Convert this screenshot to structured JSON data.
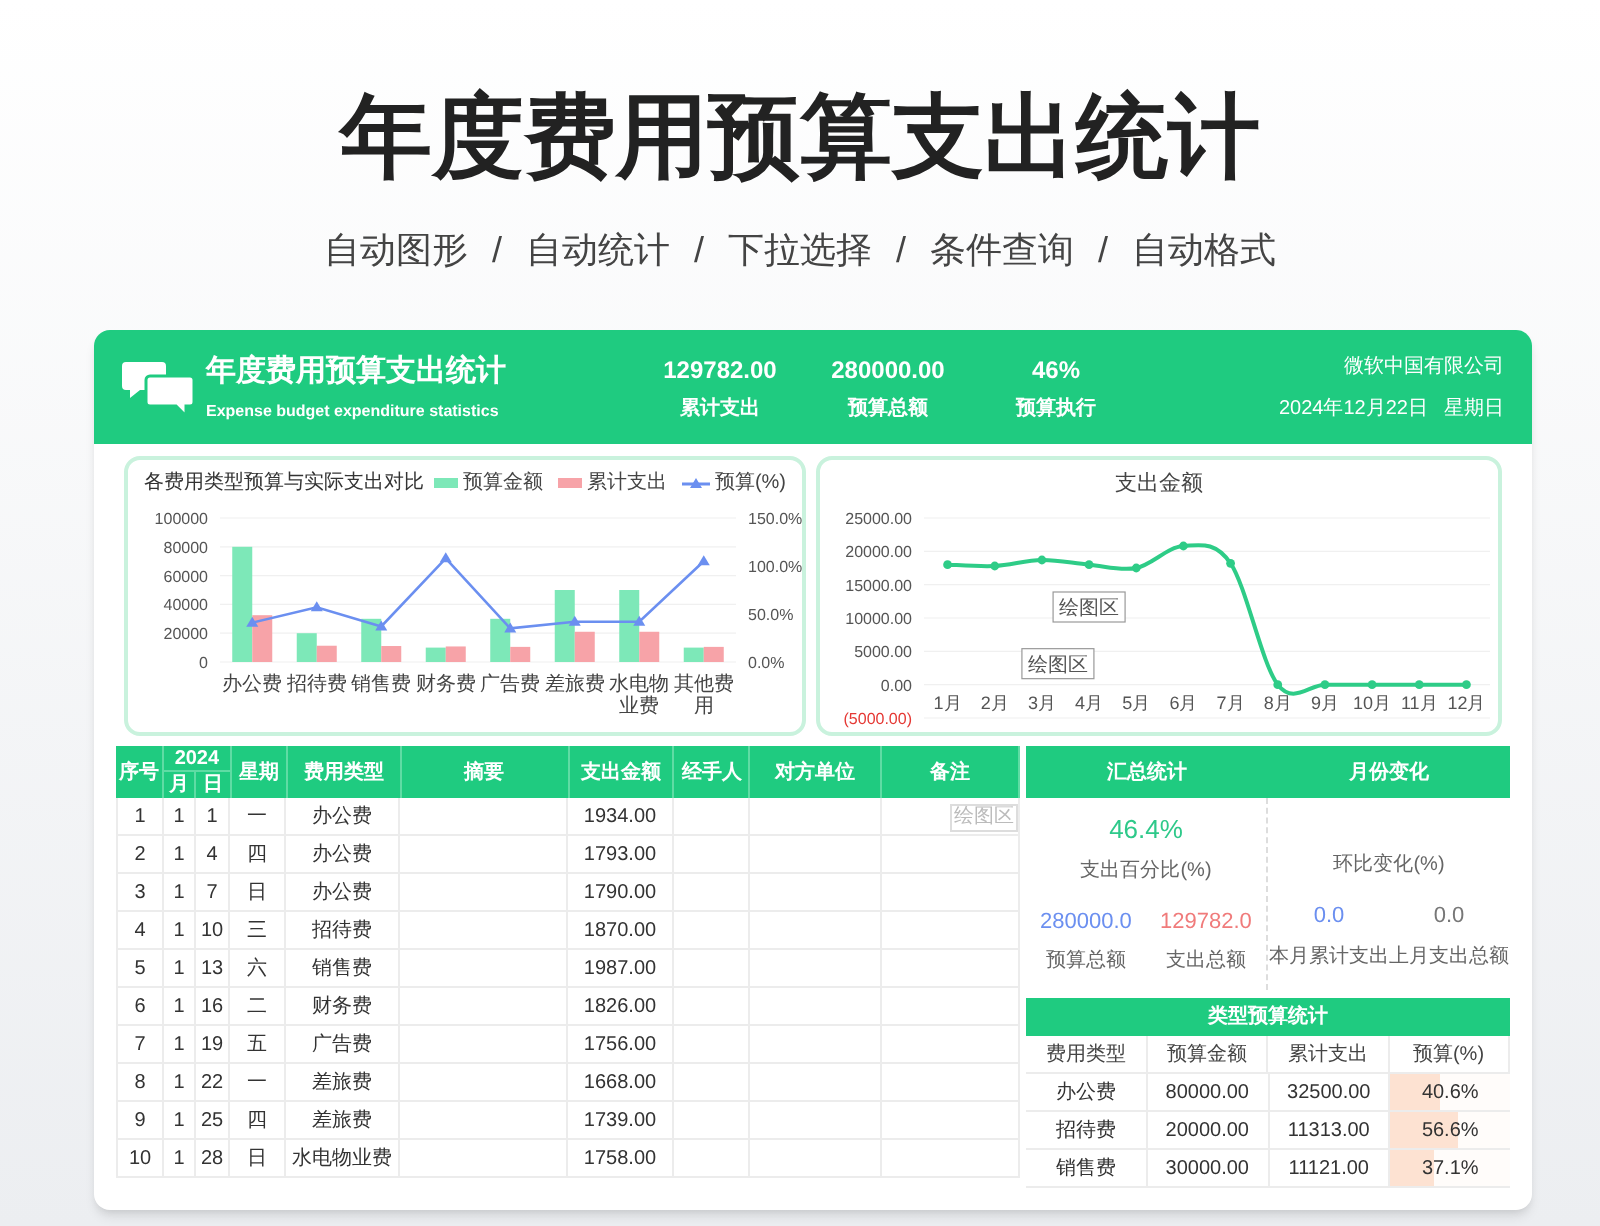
{
  "page": {
    "title": "年度费用预算支出统计",
    "features": [
      "自动图形",
      "自动统计",
      "下拉选择",
      "条件查询",
      "自动格式"
    ],
    "separator": "/"
  },
  "header": {
    "title": "年度费用预算支出统计",
    "subtitle": "Expense budget expenditure statistics",
    "stats": [
      {
        "value": "129782.00",
        "label": "累计支出"
      },
      {
        "value": "280000.00",
        "label": "预算总额"
      },
      {
        "value": "46%",
        "label": "预算执行"
      }
    ],
    "company": "微软中国有限公司",
    "date": "2024年12月22日",
    "weekday": "星期日"
  },
  "bar_chart": {
    "chart_data": {
      "type": "bar",
      "title": "各费用类型预算与实际支出对比",
      "categories": [
        "办公费",
        "招待费",
        "销售费",
        "财务费",
        "广告费",
        "差旅费",
        "水电物业费",
        "其他费用"
      ],
      "series": [
        {
          "name": "预算金额",
          "color": "#7de8b8",
          "values": [
            80000,
            20000,
            30000,
            10000,
            30000,
            50000,
            50000,
            10000
          ]
        },
        {
          "name": "累计支出",
          "color": "#f7a3a8",
          "values": [
            32500,
            11300,
            11100,
            10800,
            10500,
            21000,
            21000,
            10500
          ]
        },
        {
          "name": "预算(%)",
          "color": "#6b8ff0",
          "type": "line",
          "axis": "y2",
          "marker": "triangle",
          "values": [
            41,
            57,
            37,
            108,
            35,
            42,
            42,
            105
          ]
        }
      ],
      "ylim": [
        0,
        100000
      ],
      "yticks": [
        0,
        20000,
        40000,
        60000,
        80000,
        100000
      ],
      "y2lim": [
        0,
        150
      ],
      "y2ticks": [
        {
          "value": 0,
          "label": "0.0%"
        },
        {
          "value": 50,
          "label": "50.0%"
        },
        {
          "value": 100,
          "label": "100.0%"
        },
        {
          "value": 150,
          "label": "150.0%"
        }
      ],
      "grid": true,
      "legend": "top-right"
    }
  },
  "line_chart": {
    "chart_data": {
      "type": "line",
      "categories": [
        "1月",
        "2月",
        "3月",
        "4月",
        "5月",
        "6月",
        "7月",
        "8月",
        "9月",
        "10月",
        "11月",
        "12月"
      ],
      "series": [
        {
          "name": "支出金额",
          "color": "#2ecc87",
          "marker": "circle",
          "values": [
            18000,
            17800,
            18700,
            18000,
            17500,
            20800,
            18200,
            0,
            0,
            0,
            0,
            0
          ]
        }
      ],
      "ylim": [
        -5000,
        25000
      ],
      "yticks": [
        {
          "value": -5000,
          "label": "(5000.00)"
        },
        {
          "value": 0,
          "label": "0.00"
        },
        {
          "value": 5000,
          "label": "5000.00"
        },
        {
          "value": 10000,
          "label": "10000.00"
        },
        {
          "value": 15000,
          "label": "15000.00"
        },
        {
          "value": 20000,
          "label": "20000.00"
        },
        {
          "value": 25000,
          "label": "25000.00"
        }
      ],
      "grid": true
    },
    "plot_area_tags": [
      "绘图区",
      "绘图区"
    ]
  },
  "ledger": {
    "columns": [
      {
        "label": "序号"
      },
      {
        "label": "月",
        "group": "2024"
      },
      {
        "label": "日",
        "in_group": true
      },
      {
        "label": "星期"
      },
      {
        "label": "费用类型"
      },
      {
        "label": "摘要"
      },
      {
        "label": "支出金额"
      },
      {
        "label": "经手人"
      },
      {
        "label": "对方单位"
      },
      {
        "label": "备注"
      }
    ],
    "row_tag": "绘图区",
    "rows": [
      [
        "1",
        "1",
        "1",
        "一",
        "办公费",
        "",
        "1934.00"
      ],
      [
        "2",
        "1",
        "4",
        "四",
        "办公费",
        "",
        "1793.00"
      ],
      [
        "3",
        "1",
        "7",
        "日",
        "办公费",
        "",
        "1790.00"
      ],
      [
        "4",
        "1",
        "10",
        "三",
        "招待费",
        "",
        "1870.00"
      ],
      [
        "5",
        "1",
        "13",
        "六",
        "销售费",
        "",
        "1987.00"
      ],
      [
        "6",
        "1",
        "16",
        "二",
        "财务费",
        "",
        "1826.00"
      ],
      [
        "7",
        "1",
        "19",
        "五",
        "广告费",
        "",
        "1756.00"
      ],
      [
        "8",
        "1",
        "22",
        "一",
        "差旅费",
        "",
        "1668.00"
      ],
      [
        "9",
        "1",
        "25",
        "四",
        "差旅费",
        "",
        "1739.00"
      ],
      [
        "10",
        "1",
        "28",
        "日",
        "水电物业费",
        "",
        "1758.00"
      ]
    ]
  },
  "summary": {
    "headings": [
      "汇总统计",
      "月份变化"
    ],
    "percent": {
      "value": "46.4%",
      "label": "支出百分比(%)"
    },
    "change_label": "环比变化(%)",
    "figures": [
      {
        "value": "280000.0",
        "label": "预算总额",
        "color": "#6b8ff0"
      },
      {
        "value": "129782.0",
        "label": "支出总额",
        "color": "#f07b7b"
      },
      {
        "value": "0.0",
        "label": "本月累计支出",
        "color": "#6b8ff0"
      },
      {
        "value": "0.0",
        "label": "上月支出总额",
        "color": "#777777"
      }
    ]
  },
  "type_stats": {
    "title": "类型预算统计",
    "columns": [
      "费用类型",
      "预算金额",
      "累计支出",
      "预算(%)"
    ],
    "rows": [
      {
        "type": "办公费",
        "budget": "80000.00",
        "spent": "32500.00",
        "pct": "40.6%",
        "level": 0.406
      },
      {
        "type": "招待费",
        "budget": "20000.00",
        "spent": "11313.00",
        "pct": "56.6%",
        "level": 0.566
      },
      {
        "type": "销售费",
        "budget": "30000.00",
        "spent": "11121.00",
        "pct": "37.1%",
        "level": 0.371
      }
    ]
  }
}
